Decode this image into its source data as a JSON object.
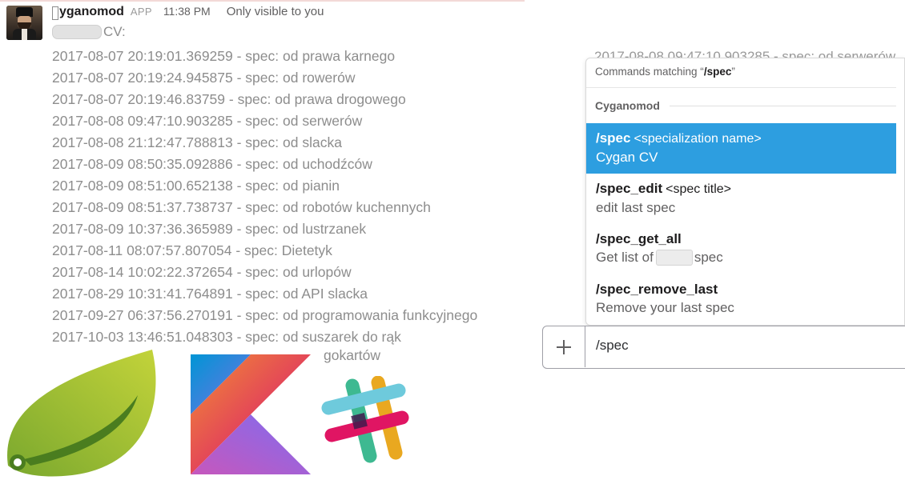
{
  "message": {
    "sender": "yganomod",
    "app_badge": "APP",
    "time": "11:38 PM",
    "visibility": "Only visible to you",
    "cv_label": "CV:",
    "entries": [
      "2017-08-07 20:19:01.369259 - spec: od prawa karnego",
      "2017-08-07 20:19:24.945875 - spec: od rowerów",
      "2017-08-07 20:19:46.83759 - spec: od prawa drogowego",
      "2017-08-08 09:47:10.903285 - spec: od serwerów",
      "2017-08-08 21:12:47.788813 - spec: od slacka",
      "2017-08-09 08:50:35.092886 - spec: od uchodźców",
      "2017-08-09 08:51:00.652138 - spec: od pianin",
      "2017-08-09 08:51:37.738737 - spec: od robotów kuchennych",
      "2017-08-09 10:37:36.365989 - spec: od lustrzanek",
      "2017-08-11 08:07:57.807054 - spec: Dietetyk",
      "2017-08-14 10:02:22.372654 - spec: od urlopów",
      "2017-08-29 10:31:41.764891 - spec: od API slacka",
      "2017-09-27 06:37:56.270191 - spec: od programowania funkcyjnego",
      "2017-10-03 13:46:51.048303 - spec: od suszarek do rąk"
    ],
    "overflow_entry": "gokartów",
    "behind_popup_text": "2017-08-08 09:47:10.903285 - spec: od serwerów"
  },
  "popup": {
    "header_prefix": "Commands matching “",
    "query": "/spec",
    "header_suffix": "”",
    "group": "Cyganomod",
    "commands": [
      {
        "name": "/spec",
        "arg": "<specialization name>",
        "desc": "Cygan CV",
        "selected": true
      },
      {
        "name": "/spec_edit",
        "arg": "<spec title>",
        "desc": "edit last spec",
        "selected": false
      },
      {
        "name": "/spec_get_all",
        "arg": "",
        "desc_before": "Get list of",
        "desc_after": "spec",
        "selected": false
      },
      {
        "name": "/spec_remove_last",
        "arg": "",
        "desc": "Remove your last spec",
        "selected": false
      }
    ]
  },
  "composer": {
    "value": "/spec",
    "plus_icon": "plus-icon"
  },
  "colors": {
    "selection": "#2d9ee0",
    "muted_text": "#8d8d8d",
    "spring_green": "#6db33f",
    "kotlin_orange": "#f18e33",
    "kotlin_purple": "#7f6cf0"
  }
}
